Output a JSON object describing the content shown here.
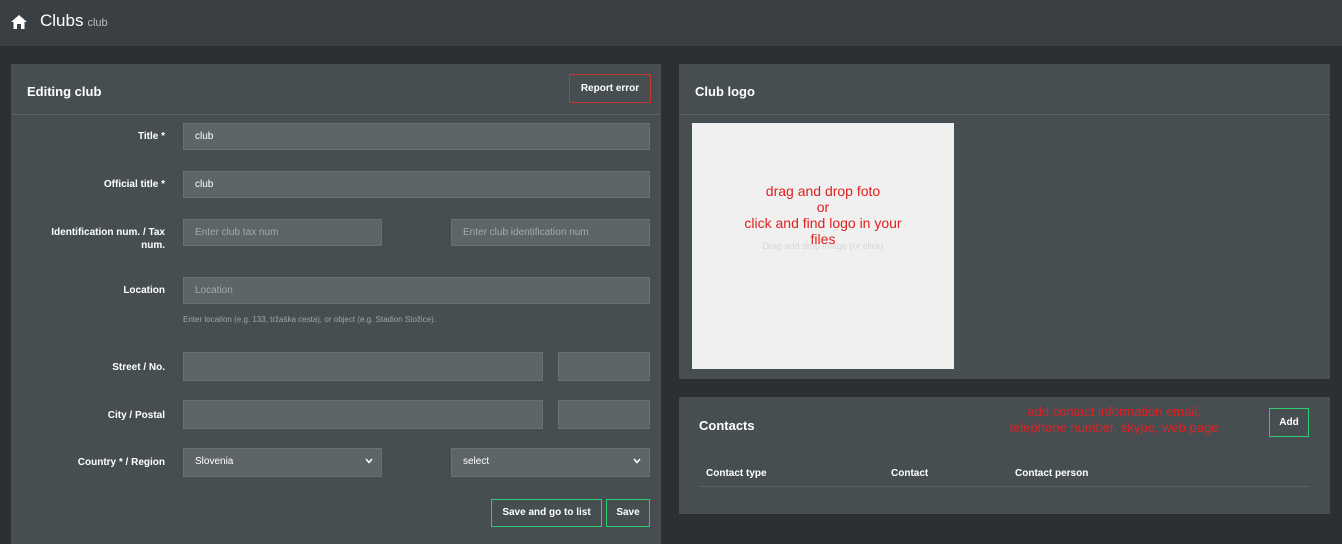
{
  "header": {
    "title": "Clubs",
    "subtitle": "club",
    "icon": "home-icon"
  },
  "edit_panel": {
    "heading": "Editing club",
    "report_button": "Report error",
    "fields": {
      "title": {
        "label": "Title *",
        "value": "club"
      },
      "official_title": {
        "label": "Official title *",
        "value": "club"
      },
      "ident": {
        "label_line1": "Identification num. / Tax",
        "label_line2": "num.",
        "tax_placeholder": "Enter club tax num",
        "ident_placeholder": "Enter club identification num"
      },
      "location": {
        "label": "Location",
        "placeholder": "Location",
        "hint": "Enter location (e.g. 133, tržaška cesta), or object (e.g. Stadion Stožice)."
      },
      "street": {
        "label": "Street / No."
      },
      "city": {
        "label": "City / Postal"
      },
      "country": {
        "label": "Country * / Region",
        "country_value": "Slovenia",
        "region_value": "select"
      }
    },
    "save_list_button": "Save and go to list",
    "save_button": "Save"
  },
  "logo_panel": {
    "heading": "Club logo",
    "dropzone_faint": "Drag and drop image (or click)",
    "annotation_line1": "drag and drop foto",
    "annotation_line2": "or",
    "annotation_line3": "click and find logo in your",
    "annotation_line4": "files"
  },
  "contacts_panel": {
    "heading": "Contacts",
    "annotation_line1": "add contact information email,",
    "annotation_line2": "telephone number, skype, web page",
    "add_button": "Add",
    "columns": [
      "Contact type",
      "Contact",
      "Contact person"
    ]
  },
  "colors": {
    "accent_green": "#2ecc71",
    "accent_red": "#c0392b",
    "annotation_red": "#e02020"
  }
}
